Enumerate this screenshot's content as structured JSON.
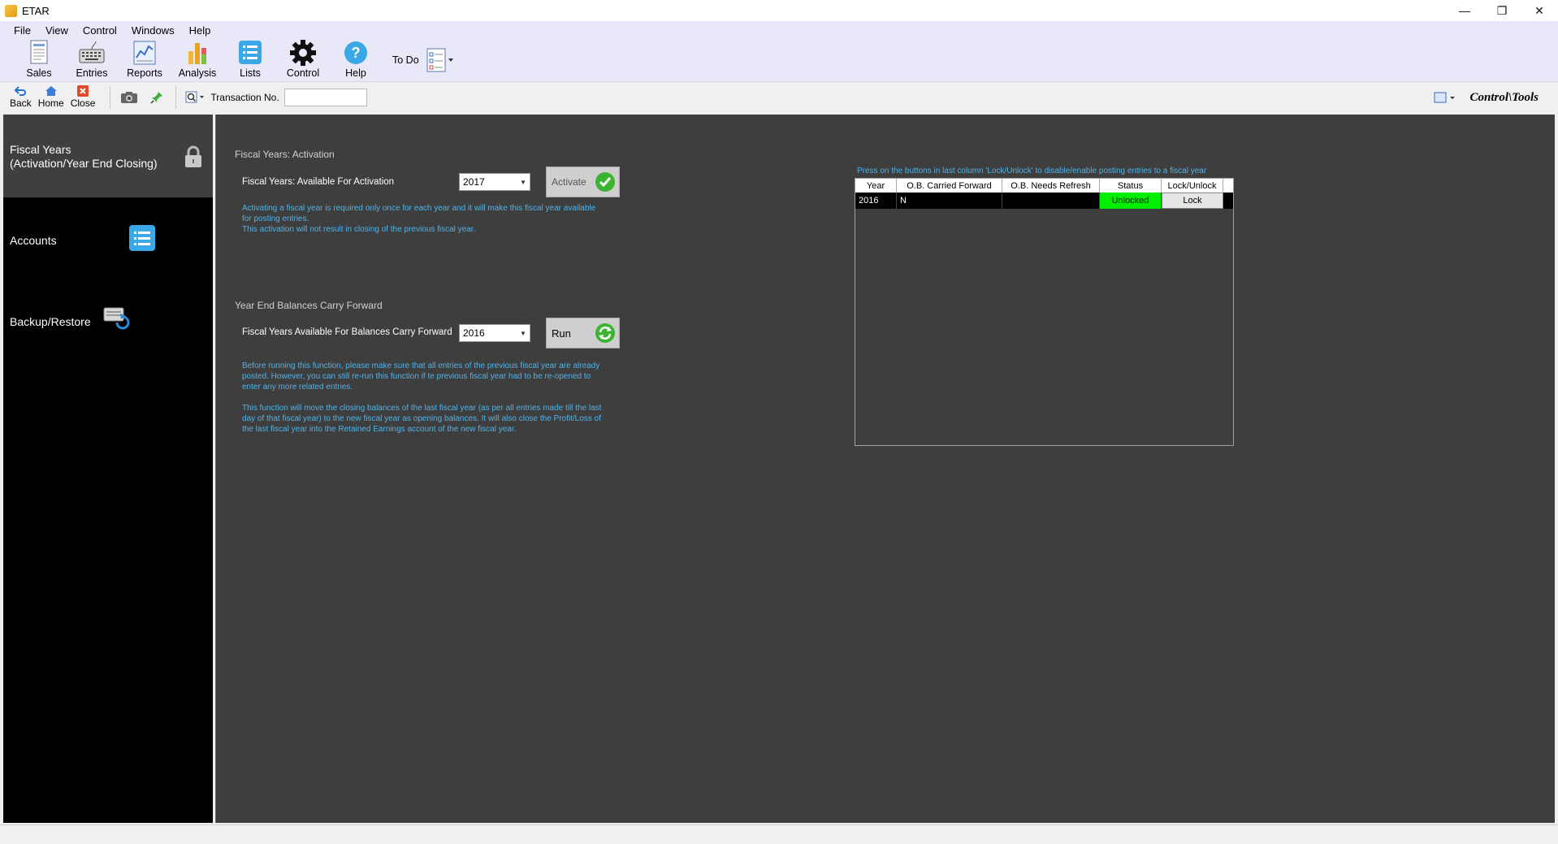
{
  "window": {
    "title": "ETAR",
    "minimize": "—",
    "restore": "❐",
    "close": "✕"
  },
  "menu": [
    "File",
    "View",
    "Control",
    "Windows",
    "Help"
  ],
  "ribbon": {
    "sales": "Sales",
    "entries": "Entries",
    "reports": "Reports",
    "analysis": "Analysis",
    "lists": "Lists",
    "control": "Control",
    "help": "Help",
    "todo": "To Do"
  },
  "toolbar": {
    "back": "Back",
    "home": "Home",
    "close": "Close",
    "transaction_label": "Transaction No.",
    "transaction_value": "",
    "context": "Control\\Tools"
  },
  "nav": {
    "fiscal_line1": "Fiscal Years",
    "fiscal_line2": "(Activation/Year End Closing)",
    "accounts": "Accounts",
    "backup": "Backup/Restore"
  },
  "activation": {
    "section_title": "Fiscal Years: Activation",
    "label": "Fiscal Years: Available For Activation",
    "selected_year": "2017",
    "button": "Activate",
    "note_line1": "Activating a fiscal year is required only once for each year and it will make this fiscal year available",
    "note_line2": "for posting entries.",
    "note_line3": "This activation will not result in closing of the previous fiscal year."
  },
  "carry_forward": {
    "section_title": "Year End Balances Carry Forward",
    "label": "Fiscal Years Available For Balances Carry Forward",
    "selected_year": "2016",
    "button": "Run",
    "note1_line1": "Before running this function, please make sure that all entries of the previous fiscal year are already",
    "note1_line2": "posted. However, you can still re-run this function if te previous fiscal year had to be re-opened to",
    "note1_line3": "enter any more related entries.",
    "note2_line1": "This function will move the closing balances of the last fiscal year (as per all entries made till the last",
    "note2_line2": "day of that fiscal year) to the new fiscal year as opening balances. It will also close the Profit/Loss of",
    "note2_line3": "the last fiscal year into the Retained Earnings account of the new fiscal year."
  },
  "grid": {
    "hint": "Press on the buttons in last column 'Lock/Unlock' to disable/enable posting entries to a fiscal year",
    "columns": [
      "Year",
      "O.B. Carried Forward",
      "O.B. Needs Refresh",
      "Status",
      "Lock/Unlock"
    ],
    "rows": [
      {
        "year": "2016",
        "carried": "N",
        "refresh": "",
        "status": "Unlocked",
        "action": "Lock"
      }
    ],
    "status_color": "#00ee00"
  }
}
